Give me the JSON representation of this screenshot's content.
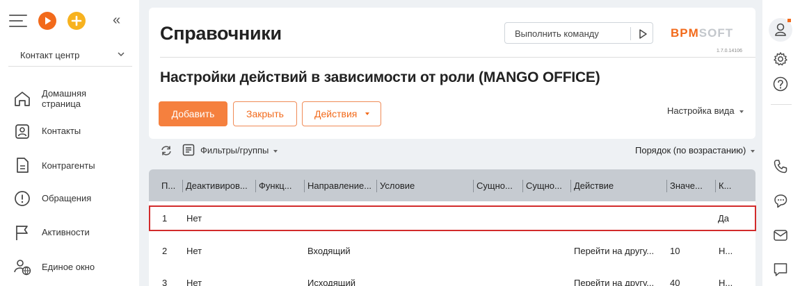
{
  "sidebar": {
    "department": "Контакт центр",
    "items": [
      {
        "label": "Домашняя\nстраница",
        "icon": "home-icon"
      },
      {
        "label": "Контакты",
        "icon": "contact-card-icon"
      },
      {
        "label": "Контрагенты",
        "icon": "document-icon"
      },
      {
        "label": "Обращения",
        "icon": "alert-circle-icon"
      },
      {
        "label": "Активности",
        "icon": "flag-icon"
      },
      {
        "label": "Единое окно",
        "icon": "user-globe-icon"
      }
    ]
  },
  "header": {
    "title": "Справочники",
    "command_placeholder": "Выполнить команду",
    "logo_part1": "BPM",
    "logo_part2": "SOFT",
    "version": "1.7.0.14106"
  },
  "section": {
    "title": "Настройки действий в зависимости от роли (MANGO OFFICE)"
  },
  "toolbar": {
    "add_label": "Добавить",
    "close_label": "Закрыть",
    "actions_label": "Действия",
    "view_settings_label": "Настройка вида"
  },
  "filters": {
    "label": "Фильтры/группы",
    "sort_label": "Порядок (по возрастанию)"
  },
  "grid": {
    "columns": [
      "П...",
      "Деактивиров...",
      "Функц...",
      "Направление...",
      "Условие",
      "Сущно...",
      "Сущно...",
      "Действие",
      "Значе...",
      "К..."
    ],
    "rows": [
      [
        "1",
        "Нет",
        "",
        "",
        "",
        "",
        "",
        "",
        "",
        "Да"
      ],
      [
        "2",
        "Нет",
        "",
        "Входящий",
        "",
        "",
        "",
        "Перейти на другу...",
        "10",
        "Н..."
      ],
      [
        "3",
        "Нет",
        "",
        "Исходящий",
        "",
        "",
        "",
        "Перейти на другу...",
        "40",
        "Н..."
      ]
    ]
  },
  "colors": {
    "accent": "#f26a1b",
    "selection_border": "#d22b2b",
    "grid_header": "#c6cbd1"
  }
}
